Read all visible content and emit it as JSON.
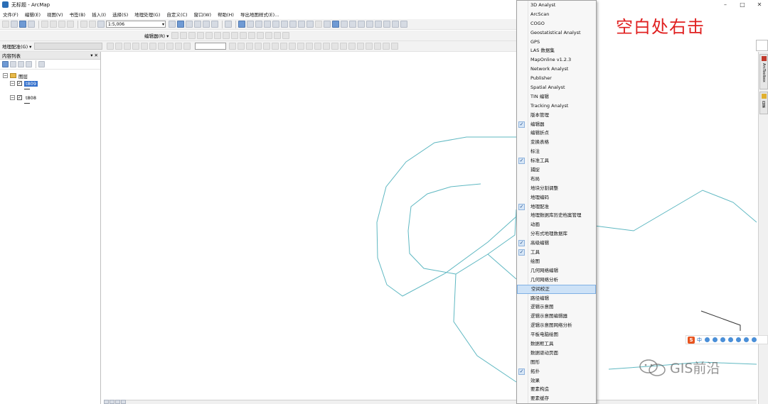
{
  "window": {
    "title": "无标题 - ArcMap",
    "controls": [
      "–",
      "□",
      "✕"
    ]
  },
  "menu": [
    "文件(F)",
    "编辑(E)",
    "视图(V)",
    "书签(B)",
    "插入(I)",
    "选择(S)",
    "地理处理(G)",
    "自定义(C)",
    "窗口(W)",
    "帮助(H)",
    "导出地图样式(E)..."
  ],
  "toolbar": {
    "scale_value": "1:5,006",
    "editor_label": "编辑器(R) ▾",
    "georef_label": "地理配准(G) ▾"
  },
  "toc": {
    "title": "内容列表",
    "pin": "▾ ✕",
    "group_label": "图层",
    "layers": [
      {
        "name": "t809",
        "selected": true
      },
      {
        "name": "t808",
        "selected": false
      }
    ]
  },
  "right_dock": {
    "tabs": [
      "ArcToolbox",
      "目录"
    ]
  },
  "annotation": {
    "text": "空白处右击",
    "color": "#e02020"
  },
  "context_menu": {
    "items": [
      {
        "label": "3D Analyst",
        "checked": false
      },
      {
        "label": "ArcScan",
        "checked": false
      },
      {
        "label": "COGO",
        "checked": false
      },
      {
        "label": "Geostatistical Analyst",
        "checked": false
      },
      {
        "label": "GPS",
        "checked": false
      },
      {
        "label": "LAS 数据集",
        "checked": false
      },
      {
        "label": "MapOnline v1.2.3",
        "checked": false
      },
      {
        "label": "Network Analyst",
        "checked": false
      },
      {
        "label": "Publisher",
        "checked": false
      },
      {
        "label": "Spatial Analyst",
        "checked": false
      },
      {
        "label": "TIN 编辑",
        "checked": false
      },
      {
        "label": "Tracking Analyst",
        "checked": false
      },
      {
        "label": "版本管理",
        "checked": false
      },
      {
        "label": "编辑器",
        "checked": true
      },
      {
        "label": "编辑折点",
        "checked": false
      },
      {
        "label": "变换表格",
        "checked": false
      },
      {
        "label": "标注",
        "checked": false
      },
      {
        "label": "标准工具",
        "checked": true
      },
      {
        "label": "捕捉",
        "checked": false
      },
      {
        "label": "布局",
        "checked": false
      },
      {
        "label": "地块分割调整",
        "checked": false
      },
      {
        "label": "地理编码",
        "checked": false
      },
      {
        "label": "地理配准",
        "checked": true
      },
      {
        "label": "地理数据库历史档案管理",
        "checked": false
      },
      {
        "label": "动画",
        "checked": false
      },
      {
        "label": "分布式地理数据库",
        "checked": false
      },
      {
        "label": "高级编辑",
        "checked": true
      },
      {
        "label": "工具",
        "checked": true
      },
      {
        "label": "绘图",
        "checked": false
      },
      {
        "label": "几何网络编辑",
        "checked": false
      },
      {
        "label": "几何网络分析",
        "checked": false
      },
      {
        "label": "空间校正",
        "checked": false,
        "highlighted": true
      },
      {
        "label": "路径编辑",
        "checked": false
      },
      {
        "label": "逻辑示意图",
        "checked": false
      },
      {
        "label": "逻辑示意图编辑器",
        "checked": false
      },
      {
        "label": "逻辑示意图网络分析",
        "checked": false
      },
      {
        "label": "平板电脑绘图",
        "checked": false
      },
      {
        "label": "数据框工具",
        "checked": false
      },
      {
        "label": "数据驱动页面",
        "checked": false
      },
      {
        "label": "图形",
        "checked": false
      },
      {
        "label": "拓扑",
        "checked": true
      },
      {
        "label": "效果",
        "checked": false
      },
      {
        "label": "要素构造",
        "checked": false
      },
      {
        "label": "要素缓存",
        "checked": false
      }
    ]
  },
  "ime": {
    "logo": "S",
    "mode": "中"
  },
  "watermark": {
    "text": "GIS前沿"
  },
  "map": {
    "line_color": "#5fb8c2",
    "line_color_dark": "#333333"
  }
}
